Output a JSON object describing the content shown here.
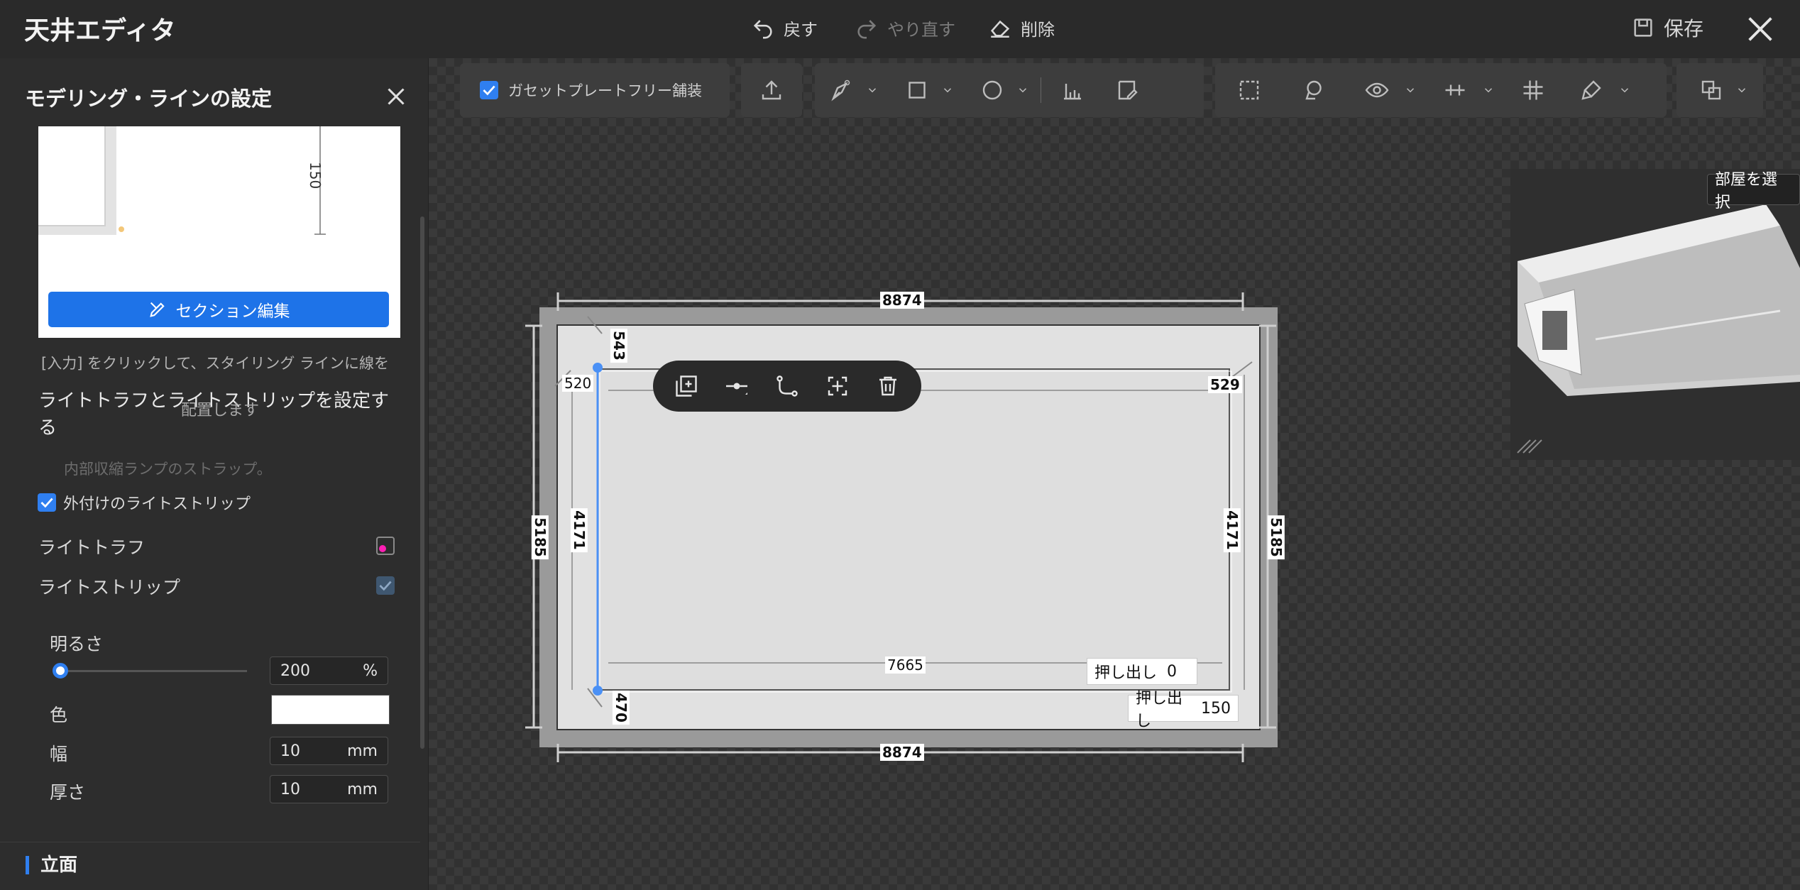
{
  "header": {
    "title": "天井エディタ",
    "undo_label": "戻す",
    "redo_label": "やり直す",
    "delete_label": "削除",
    "save_label": "保存"
  },
  "panel": {
    "title": "モデリング・ラインの設定",
    "preview_dim": "150",
    "section_edit_label": "セクション編集",
    "hint": "[入力] をクリックして、スタイリング ラインに線を",
    "hint_cont": "配置します",
    "section_heading": "ライトトラフとライトストリップを設定する",
    "faint_text": "内部収縮ランプのストラップ。",
    "external_strip_label": "外付けのライトストリップ",
    "light_trough_label": "ライトトラフ",
    "light_strip_label": "ライトストリップ",
    "brightness_label": "明るさ",
    "brightness_value": "200",
    "brightness_unit": "%",
    "brightness_level": 0.0,
    "color_label": "色",
    "color_value": "#ffffff",
    "width_label": "幅",
    "width_value": "10",
    "width_unit": "mm",
    "thickness_label": "厚さ",
    "thickness_value": "10",
    "thickness_unit": "mm",
    "elevation_label": "立面",
    "external_strip_checked": true,
    "light_trough_checked": false,
    "light_strip_checked": true
  },
  "toolbar": {
    "gasket_label": "ガセットプレートフリー舗装",
    "gasket_checked": true,
    "icons": [
      "upload-icon",
      "pen-tool-icon",
      "rectangle-icon",
      "circle-icon",
      "measure-icon",
      "edit-panel-icon",
      "select-area-icon",
      "lasso-icon",
      "eye-icon",
      "align-icon",
      "grid-icon",
      "paint-icon",
      "layers-icon"
    ]
  },
  "drawing": {
    "outer_width": "8874",
    "outer_width_bottom": "8874",
    "outer_height_left": "5185",
    "outer_height_right": "5185",
    "top_left_offset": "543",
    "left_offset": "520",
    "right_offset": "529",
    "inner_height_left": "4171",
    "inner_height_right": "4171",
    "inner_width": "7665",
    "bottom_left_offset": "470",
    "extrude_label": "押し出し",
    "extrude_inner": "0",
    "extrude_outer": "150"
  },
  "float_toolbar": [
    "add-copy-icon",
    "split-point-icon",
    "path-icon",
    "fit-icon",
    "trash-icon"
  ],
  "preview3d": {
    "select_room_label": "部屋を選択"
  },
  "colors": {
    "accent": "#1e73e8",
    "checkbox_on": "#2f7ff0",
    "selection_line": "#4a90f5"
  }
}
